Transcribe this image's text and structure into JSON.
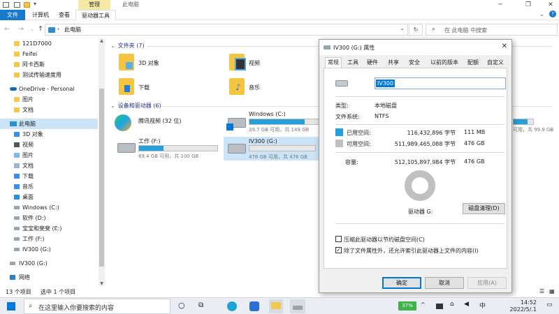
{
  "explorer": {
    "title": "此电脑",
    "tool_tab": "管理",
    "ribbon_tabs": [
      "文件",
      "计算机",
      "查看",
      "驱动器工具"
    ],
    "address": "此电脑",
    "search_placeholder": "在 此电脑 中搜索",
    "sidebar": [
      {
        "label": "121D7000",
        "icon": "folder-icon"
      },
      {
        "label": "Feifei",
        "icon": "folder-icon"
      },
      {
        "label": "阿卡西斯",
        "icon": "folder-icon"
      },
      {
        "label": "测试传输速度用",
        "icon": "folder-icon"
      },
      {
        "label": "OneDrive - Personal",
        "icon": "cloud-icon"
      },
      {
        "label": "图片",
        "icon": "folder-icon"
      },
      {
        "label": "文档",
        "icon": "folder-icon"
      },
      {
        "label": "此电脑",
        "icon": "pc-icon"
      },
      {
        "label": "3D 对象",
        "icon": "3d-objects-icon"
      },
      {
        "label": "视频",
        "icon": "video-icon"
      },
      {
        "label": "图片",
        "icon": "pictures-icon"
      },
      {
        "label": "文档",
        "icon": "documents-icon"
      },
      {
        "label": "下载",
        "icon": "download-icon"
      },
      {
        "label": "音乐",
        "icon": "music-icon"
      },
      {
        "label": "桌面",
        "icon": "desktop-icon"
      },
      {
        "label": "Windows (C:)",
        "icon": "drive-icon"
      },
      {
        "label": "软件 (D:)",
        "icon": "drive-icon"
      },
      {
        "label": "宝宝和斐斐 (E:)",
        "icon": "drive-icon"
      },
      {
        "label": "工作 (F:)",
        "icon": "drive-icon"
      },
      {
        "label": "IV300 (G:)",
        "icon": "drive-icon"
      },
      {
        "label": "IV300 (G:)",
        "icon": "drive-icon"
      },
      {
        "label": "网络",
        "icon": "network-icon"
      }
    ],
    "folders_group": "文件夹 (7)",
    "folders": [
      "3D 对象",
      "视频",
      "下载",
      "音乐"
    ],
    "drives_group": "设备和驱动器 (6)",
    "tencent": "腾讯视频 (32 位)",
    "drives": [
      {
        "name": "Windows (C:)",
        "sub": "39.7 GB 可用，共 149 GB",
        "used_fraction": 0.73
      },
      {
        "name": "工作 (F:)",
        "sub": "69.4 GB 可用，共 100 GB",
        "used_fraction": 0.31
      },
      {
        "name": "IV300 (G:)",
        "sub": "476 GB 可用，共 476 GB",
        "used_fraction": 0.0
      }
    ],
    "partial_drive_sub": "可用，共 99.9 GB",
    "status_count": "13 个项目",
    "status_selected": "选中 1 个项目"
  },
  "dialog": {
    "title": "IV300 (G:) 属性",
    "tabs": [
      "常规",
      "工具",
      "硬件",
      "共享",
      "安全",
      "以前的版本",
      "配额",
      "自定义"
    ],
    "name_value": "IV300",
    "type_label": "类型:",
    "type_value": "本地磁盘",
    "fs_label": "文件系统:",
    "fs_value": "NTFS",
    "used_label": "已用空间:",
    "used_bytes": "116,432,896 字节",
    "used_size": "111 MB",
    "free_label": "可用空间:",
    "free_bytes": "511,989,465,088 字节",
    "free_size": "476 GB",
    "cap_label": "容量:",
    "cap_bytes": "512,105,897,984 字节",
    "cap_size": "476 GB",
    "drive_label": "驱动器 G:",
    "cleanup": "磁盘清理(D)",
    "compress": "压缩此驱动器以节约磁盘空间(C)",
    "index": "除了文件属性外，还允许索引此驱动器上文件的内容(I)",
    "ok": "确定",
    "cancel": "取消",
    "apply": "应用(A)",
    "colors": {
      "used": "#26a0da",
      "free": "#c0c0c0"
    }
  },
  "taskbar": {
    "search_placeholder": "在这里输入你要搜索的内容",
    "battery": "37%",
    "time": "14:52",
    "date": "2022/5/.1"
  }
}
